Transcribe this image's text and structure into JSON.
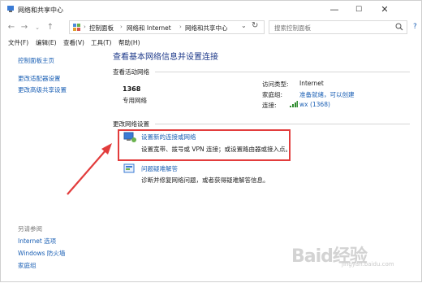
{
  "window": {
    "title": "网络和共享中心",
    "controls": [
      "—",
      "☐",
      "✕"
    ]
  },
  "address": {
    "crumbs": [
      "控制面板",
      "网络和 Internet",
      "网络和共享中心"
    ],
    "search_placeholder": "搜索控制面板"
  },
  "menu": [
    "文件(F)",
    "编辑(E)",
    "查看(V)",
    "工具(T)",
    "帮助(H)"
  ],
  "sidebar": {
    "links": [
      "控制面板主页",
      "更改适配器设置",
      "更改高级共享设置"
    ],
    "see_also_label": "另请参阅",
    "see_also": [
      "Internet 选项",
      "Windows 防火墙",
      "家庭组"
    ]
  },
  "main": {
    "title": "查看基本网络信息并设置连接",
    "active_section": "查看活动网络",
    "network_name": "1368",
    "network_type": "专用网络",
    "access_type_label": "访问类型:",
    "access_type_value": "Internet",
    "homegroup_label": "家庭组:",
    "homegroup_value": "准备就绪，可以创建",
    "connection_label": "连接:",
    "connection_value": "wx (1368)",
    "change_section": "更改网络设置",
    "tasks": [
      {
        "title": "设置新的连接或网络",
        "desc": "设置宽带、拨号或 VPN 连接；或设置路由器或接入点。"
      },
      {
        "title": "问题疑难解答",
        "desc": "诊断并修复网络问题，或者获得疑难解答信息。"
      }
    ]
  },
  "colors": {
    "link": "#1a5fb4",
    "highlight": "#e23c3c",
    "title": "#1e3a8a"
  },
  "watermark": {
    "text": "Baid经验",
    "sub": "jingyan.baidu.com"
  }
}
